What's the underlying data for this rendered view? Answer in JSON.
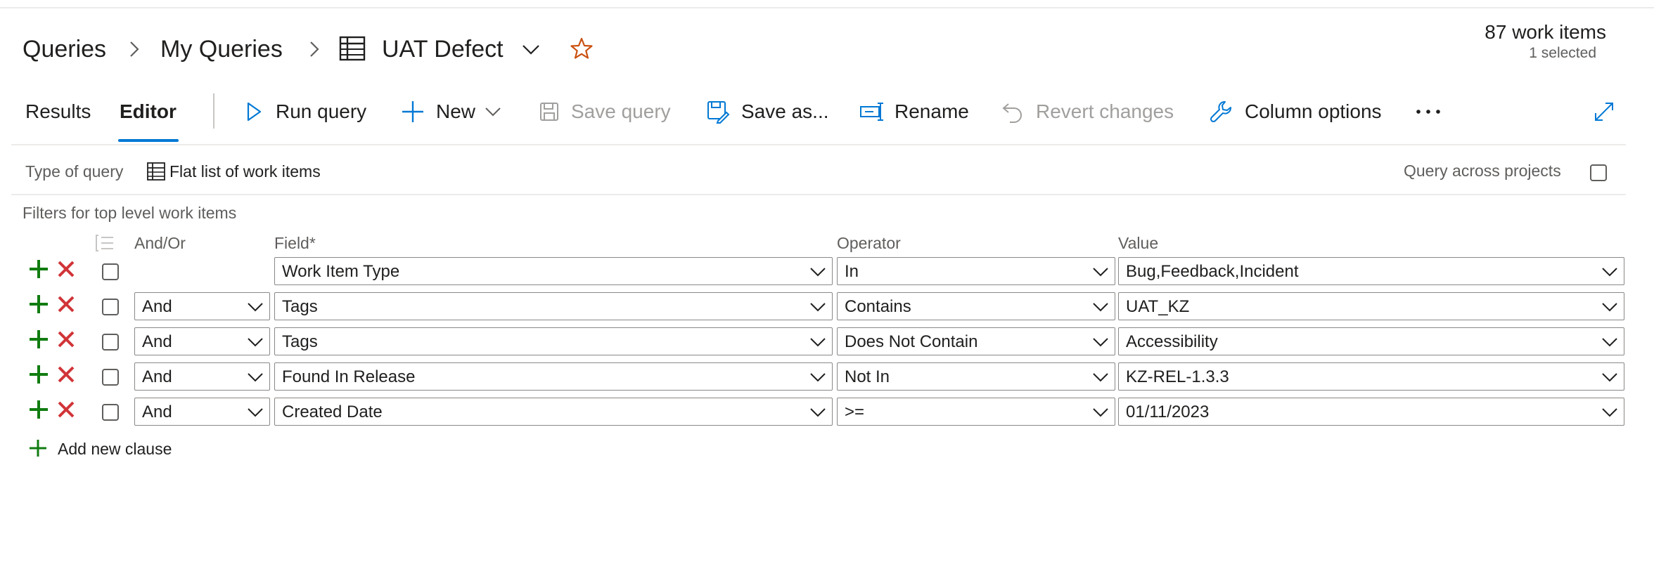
{
  "breadcrumb": {
    "root": "Queries",
    "parent": "My Queries",
    "current": "UAT Defect"
  },
  "summary": {
    "count": "87 work items",
    "selected": "1 selected"
  },
  "tabs": {
    "results": "Results",
    "editor": "Editor"
  },
  "toolbar": {
    "run_query": "Run query",
    "new": "New",
    "save_query": "Save query",
    "save_as": "Save as...",
    "rename": "Rename",
    "revert": "Revert changes",
    "column_options": "Column options"
  },
  "query_type": {
    "label": "Type of query",
    "value": "Flat list of work items",
    "across_projects": "Query across projects"
  },
  "filters": {
    "title": "Filters for top level work items",
    "headers": {
      "andor": "And/Or",
      "field": "Field*",
      "operator": "Operator",
      "value": "Value"
    },
    "rows": [
      {
        "andor": "",
        "field": "Work Item Type",
        "operator": "In",
        "value": "Bug,Feedback,Incident"
      },
      {
        "andor": "And",
        "field": "Tags",
        "operator": "Contains",
        "value": "UAT_KZ"
      },
      {
        "andor": "And",
        "field": "Tags",
        "operator": "Does Not Contain",
        "value": "Accessibility"
      },
      {
        "andor": "And",
        "field": "Found In Release",
        "operator": "Not In",
        "value": "KZ-REL-1.3.3"
      },
      {
        "andor": "And",
        "field": "Created Date",
        "operator": ">=",
        "value": "01/11/2023"
      }
    ],
    "add_clause": "Add new clause"
  },
  "colors": {
    "accent": "#0078d4",
    "add_green": "#107c10",
    "delete_red": "#d13438",
    "star": "#ca5010"
  }
}
